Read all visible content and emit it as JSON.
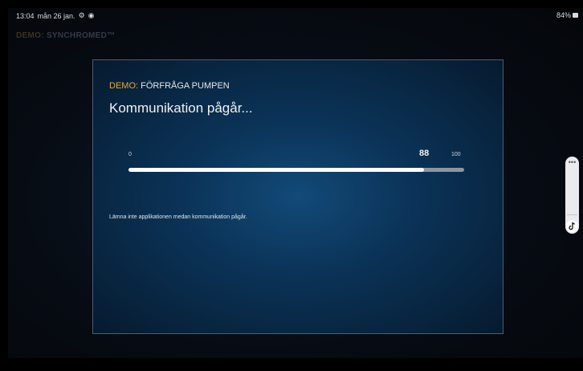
{
  "status_bar": {
    "time": "13:04",
    "date": "mån 26 jan.",
    "battery": "84%"
  },
  "app": {
    "brand_prefix": "DEMO:",
    "brand_name": "SYNCHROMED™"
  },
  "modal": {
    "kicker_prefix": "DEMO:",
    "kicker_text": "FÖRFRÅGA PUMPEN",
    "title": "Kommunikation pågår...",
    "progress": {
      "min_label": "0",
      "max_label": "100",
      "value": 88,
      "value_label": "88"
    },
    "warning": "Lämna inte applikationen medan kommunikation pågår."
  },
  "colors": {
    "accent_demo": "#e8a83a",
    "modal_border": "#4a5e75",
    "progress_fill": "#ffffff",
    "progress_track": "#8a96a6"
  },
  "icons": {
    "status_icons": [
      "settings-icon",
      "location-icon"
    ],
    "side_widget": [
      "more-icon",
      "tiktok-icon"
    ]
  }
}
